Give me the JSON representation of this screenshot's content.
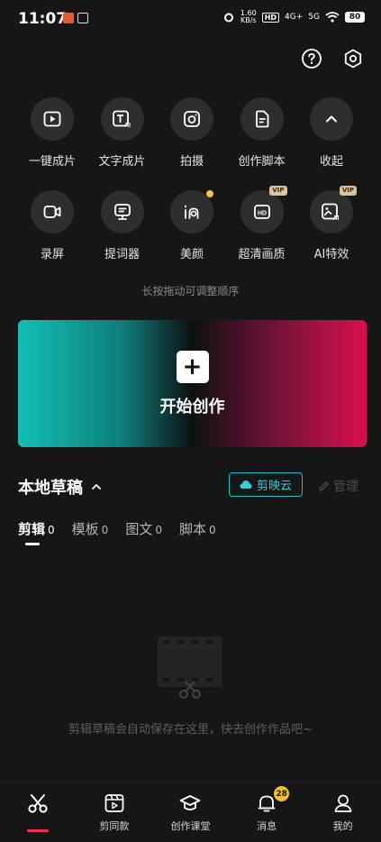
{
  "status": {
    "time": "11:07",
    "net_speed_value": "1.60",
    "net_speed_unit": "KB/s",
    "hd_label": "HD",
    "sig1_label": "4G+",
    "sig2_label": "5G",
    "battery": "80"
  },
  "tools": [
    {
      "label": "一键成片",
      "icon": "play-box-icon"
    },
    {
      "label": "文字成片",
      "icon": "text-ai-icon"
    },
    {
      "label": "拍摄",
      "icon": "camera-icon"
    },
    {
      "label": "创作脚本",
      "icon": "script-icon"
    },
    {
      "label": "收起",
      "icon": "chevron-up-icon"
    },
    {
      "label": "录屏",
      "icon": "video-camera-icon"
    },
    {
      "label": "提词器",
      "icon": "teleprompter-icon"
    },
    {
      "label": "美颜",
      "icon": "beauty-icon"
    },
    {
      "label": "超清画质",
      "icon": "hd-icon",
      "badge": "VIP"
    },
    {
      "label": "AI特效",
      "icon": "ai-effect-icon",
      "badge": "VIP"
    }
  ],
  "hint": "长按拖动可调整顺序",
  "hd_icon_text": "HD",
  "ai_icon_text": "AI",
  "create": {
    "plus": "+",
    "label": "开始创作"
  },
  "drafts": {
    "title": "本地草稿",
    "cloud": "剪映云",
    "manage": "管理"
  },
  "tabs": [
    {
      "label": "剪辑",
      "count": "0"
    },
    {
      "label": "模板",
      "count": "0"
    },
    {
      "label": "图文",
      "count": "0"
    },
    {
      "label": "脚本",
      "count": "0"
    }
  ],
  "empty_text": "剪辑草稿会自动保存在这里，快去创作作品吧~",
  "nav": [
    {
      "label": "",
      "icon": "scissors-icon"
    },
    {
      "label": "剪同款",
      "icon": "clapper-icon"
    },
    {
      "label": "创作课堂",
      "icon": "graduation-cap-icon"
    },
    {
      "label": "消息",
      "icon": "bell-icon",
      "badge": "28"
    },
    {
      "label": "我的",
      "icon": "user-icon"
    }
  ],
  "colors": {
    "accent": "#fe2c55",
    "cloud": "#19c0c9",
    "badge": "#f6c21b"
  }
}
